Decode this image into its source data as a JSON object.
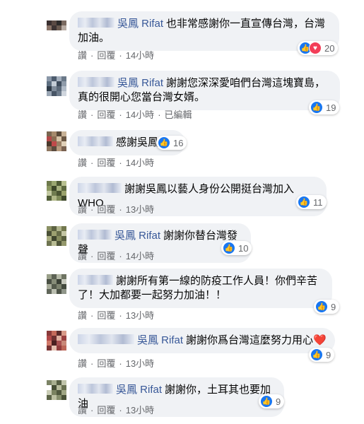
{
  "labels": {
    "like": "讚",
    "reply": "回覆",
    "dot": "·",
    "edited": "已編輯"
  },
  "icons": {
    "like": "thumbs-up-icon",
    "love": "heart-icon"
  },
  "colors": {
    "author": "#385898",
    "like": "#1877f2",
    "love": "#f33e58",
    "bubble": "#f0f2f5"
  },
  "comments": [
    {
      "author": "吳鳳 Rifat",
      "text": "也非常感謝你一直宣傳台灣，台灣加油。",
      "count": "20",
      "time": "14小時"
    },
    {
      "author": "吳鳳 Rifat",
      "text": "謝謝您深深愛咱們台灣這塊寶島，真的很開心您當台灣女婿。",
      "count": "19",
      "time": "14小時"
    },
    {
      "text": "感謝吳鳳",
      "count": "16",
      "time": "14小時"
    },
    {
      "text": "謝謝吳鳳以藝人身份公開挺台灣加入WHO",
      "count": "11",
      "time": "13小時"
    },
    {
      "author": "吳鳳 Rifat",
      "text": "謝謝你替台灣發聲",
      "count": "10",
      "time": "14小時"
    },
    {
      "text": "謝謝所有第一線的防疫工作人員！你們辛苦了！大加都要一起努力加油！！",
      "count": "9",
      "time": "13小時"
    },
    {
      "author": "吳鳳 Rifat",
      "text": "謝謝你爲台灣這麼努力用心",
      "emoji": "❤️",
      "count": "9",
      "time": "13小時"
    },
    {
      "author": "吳鳳 Rifat",
      "text": "謝謝你，土耳其也要加油",
      "count": "9",
      "time": "13小時"
    }
  ]
}
